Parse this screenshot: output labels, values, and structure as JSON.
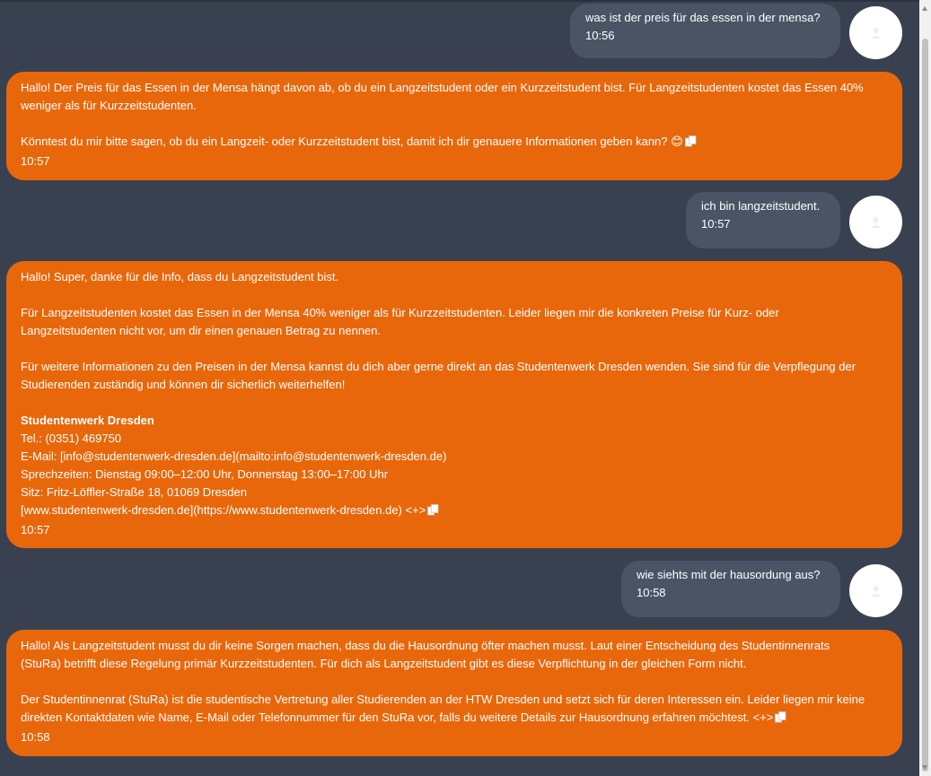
{
  "messages": [
    {
      "role": "user",
      "lines": [
        "was ist der preis für das essen in der mensa?"
      ],
      "time": "10:56"
    },
    {
      "role": "assistant",
      "lines": [
        "Hallo! Der Preis für das Essen in der Mensa hängt davon ab, ob du ein Langzeitstudent oder ein Kurzzeitstudent bist. Für Langzeitstudenten kostet das Essen 40%",
        "weniger als für Kurzzeitstudenten.",
        "",
        "Könntest du mir bitte sagen, ob du ein Langzeit- oder Kurzzeitstudent bist, damit ich dir genauere Informationen geben kann? 😊"
      ],
      "time": "10:57"
    },
    {
      "role": "user",
      "lines": [
        "ich bin langzeitstudent."
      ],
      "time": "10:57"
    },
    {
      "role": "assistant",
      "lines": [
        "Hallo! Super, danke für die Info, dass du Langzeitstudent bist.",
        "",
        "Für Langzeitstudenten kostet das Essen in der Mensa 40% weniger als für Kurzzeitstudenten. Leider liegen mir die konkreten Preise für Kurz- oder",
        "Langzeitstudenten nicht vor, um dir einen genauen Betrag zu nennen.",
        "",
        "Für weitere Informationen zu den Preisen in der Mensa kannst du dich aber gerne direkt an das Studentenwerk Dresden wenden. Sie sind für die Verpflegung der",
        "Studierenden zuständig und können dir sicherlich weiterhelfen!",
        "",
        "Studentenwerk Dresden",
        "Tel.: (0351) 469750",
        "E-Mail: [info@studentenwerk-dresden.de](mailto:info@studentenwerk-dresden.de)",
        "Sprechzeiten: Dienstag 09:00–12:00 Uhr, Donnerstag 13:00–17:00 Uhr",
        "Sitz: Fritz-Löffler-Straße 18, 01069 Dresden",
        "[www.studentenwerk-dresden.de](https://www.studentenwerk-dresden.de) <+>"
      ],
      "bold_line": 8,
      "time": "10:57"
    },
    {
      "role": "user",
      "lines": [
        "wie siehts mit der hausordung aus?"
      ],
      "time": "10:58"
    },
    {
      "role": "assistant",
      "lines": [
        "Hallo! Als Langzeitstudent musst du dir keine Sorgen machen, dass du die Hausordnung öfter machen musst. Laut einer Entscheidung des Studentinnenrats",
        "(StuRa) betrifft diese Regelung primär Kurzzeitstudenten. Für dich als Langzeitstudent gibt es diese Verpflichtung in der gleichen Form nicht.",
        "",
        "Der Studentinnenrat (StuRa) ist die studentische Vertretung aller Studierenden an der HTW Dresden und setzt sich für deren Interessen ein. Leider liegen mir keine",
        "direkten Kontaktdaten wie Name, E-Mail oder Telefonnummer für den StuRa vor, falls du weitere Details zur Hausordnung erfahren möchtest. <+>"
      ],
      "time": "10:58"
    }
  ],
  "icons": {
    "avatar": "user-avatar-icon",
    "copy": "copy-icon"
  },
  "colors": {
    "background": "#394150",
    "user_bubble": "#4b5465",
    "assistant_bubble": "#e9670b"
  }
}
